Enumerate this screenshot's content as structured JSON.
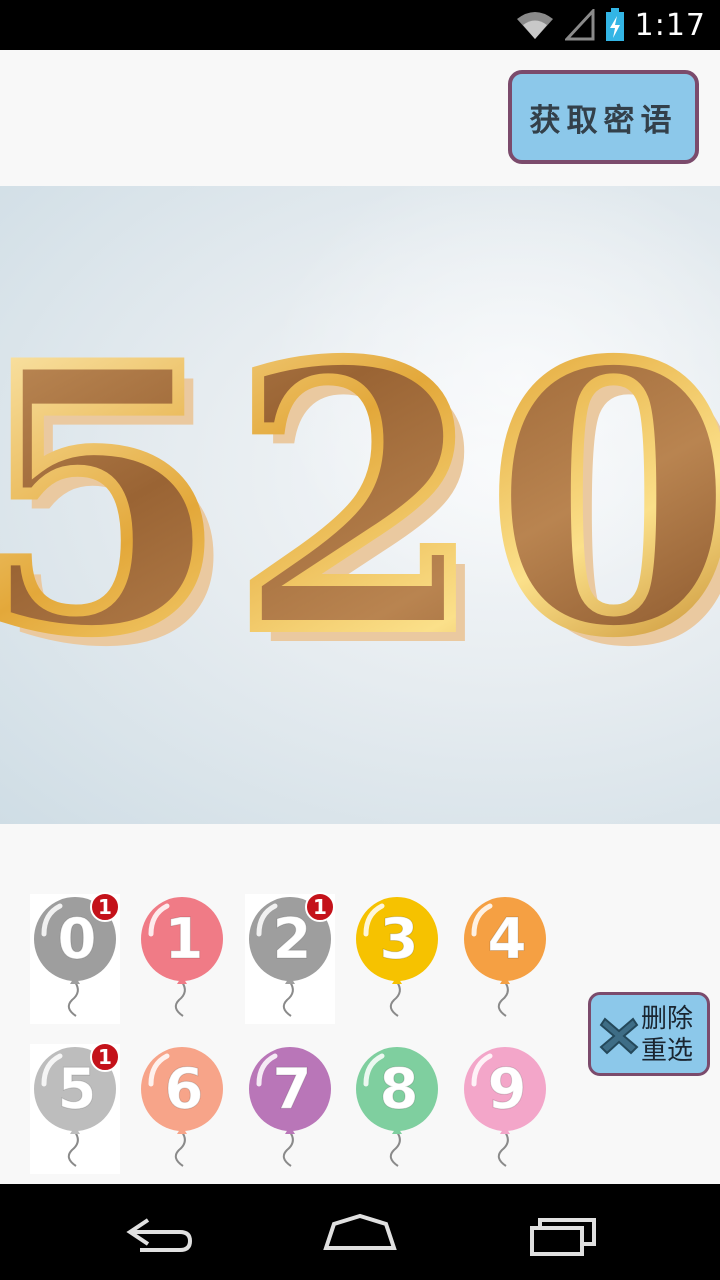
{
  "status_bar": {
    "time": "1:17",
    "icons": [
      "wifi-icon",
      "signal-icon",
      "battery-charging-icon"
    ]
  },
  "top": {
    "get_phrase_button": "获取密语"
  },
  "picture": {
    "text": "520"
  },
  "digit_keys": [
    {
      "digit": "0",
      "color": "#9e9e9e",
      "used": true,
      "badge": "1"
    },
    {
      "digit": "1",
      "color": "#f07b86",
      "used": false,
      "badge": ""
    },
    {
      "digit": "2",
      "color": "#9e9e9e",
      "used": true,
      "badge": "1"
    },
    {
      "digit": "3",
      "color": "#f6c200",
      "used": false,
      "badge": ""
    },
    {
      "digit": "4",
      "color": "#f5a043",
      "used": false,
      "badge": ""
    },
    {
      "digit": "5",
      "color": "#bdbdbd",
      "used": true,
      "badge": "1"
    },
    {
      "digit": "6",
      "color": "#f7a489",
      "used": false,
      "badge": ""
    },
    {
      "digit": "7",
      "color": "#b976b8",
      "used": false,
      "badge": ""
    },
    {
      "digit": "8",
      "color": "#7fcf9f",
      "used": false,
      "badge": ""
    },
    {
      "digit": "9",
      "color": "#f3a6c9",
      "used": false,
      "badge": ""
    }
  ],
  "delete_button": {
    "line1": "删除",
    "line2": "重选",
    "icon": "close-x-icon"
  },
  "nav_bar": {
    "icons": [
      "back-icon",
      "home-icon",
      "recents-icon"
    ]
  },
  "colors": {
    "button_bg": "#8cc8ea",
    "button_border": "#7b4b6c",
    "badge": "#c4121a"
  }
}
